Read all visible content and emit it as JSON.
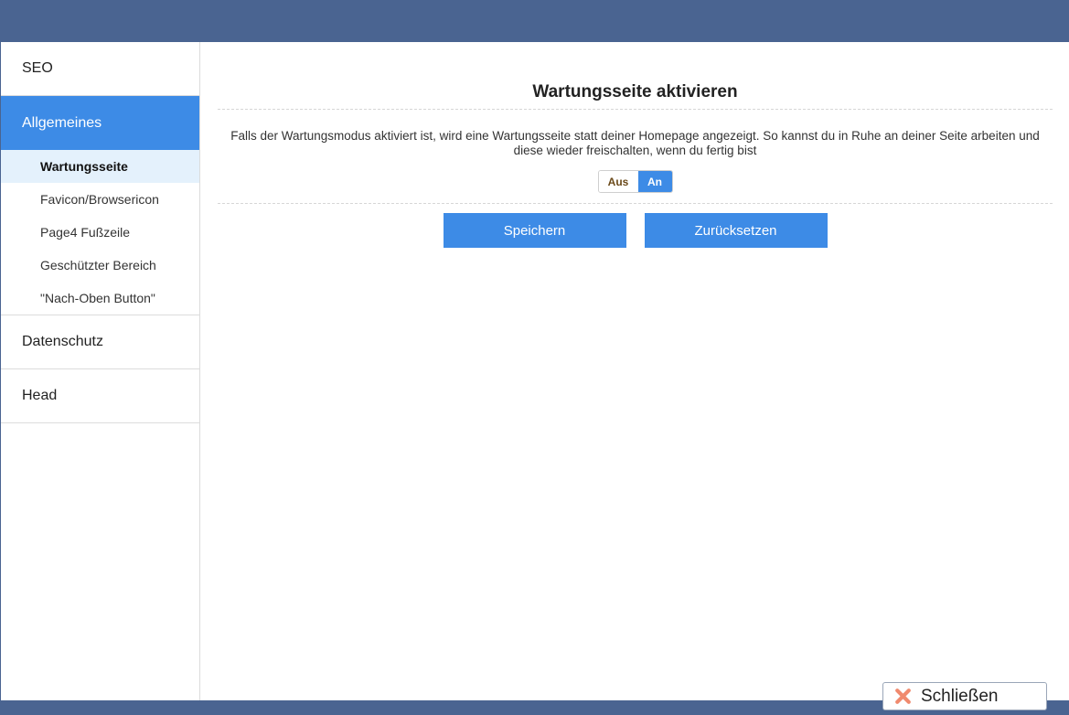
{
  "sidebar": {
    "items": [
      {
        "label": "SEO"
      },
      {
        "label": "Allgemeines"
      },
      {
        "label": "Datenschutz"
      },
      {
        "label": "Head"
      }
    ],
    "subitems": [
      {
        "label": "Wartungsseite"
      },
      {
        "label": "Favicon/Browsericon"
      },
      {
        "label": "Page4 Fußzeile"
      },
      {
        "label": "Geschützter Bereich"
      },
      {
        "label": "\"Nach-Oben Button\""
      }
    ]
  },
  "main": {
    "title": "Wartungsseite aktivieren",
    "description_line1": "Falls der Wartungsmodus aktiviert ist, wird eine Wartungsseite statt deiner Homepage angezeigt. So kannst du in Ruhe an deiner Seite arbeiten und",
    "description_line2": "diese wieder freischalten, wenn du fertig bist",
    "toggle": {
      "off_label": "Aus",
      "on_label": "An",
      "selected": "An"
    },
    "save_label": "Speichern",
    "reset_label": "Zurücksetzen"
  },
  "footer": {
    "close_label": "Schließen"
  },
  "colors": {
    "frame": "#4a6491",
    "accent": "#3d8be6",
    "subitem_active_bg": "#e4f1fc",
    "close_icon": "#f08a6e"
  },
  "icons": {
    "close": "close-icon"
  }
}
